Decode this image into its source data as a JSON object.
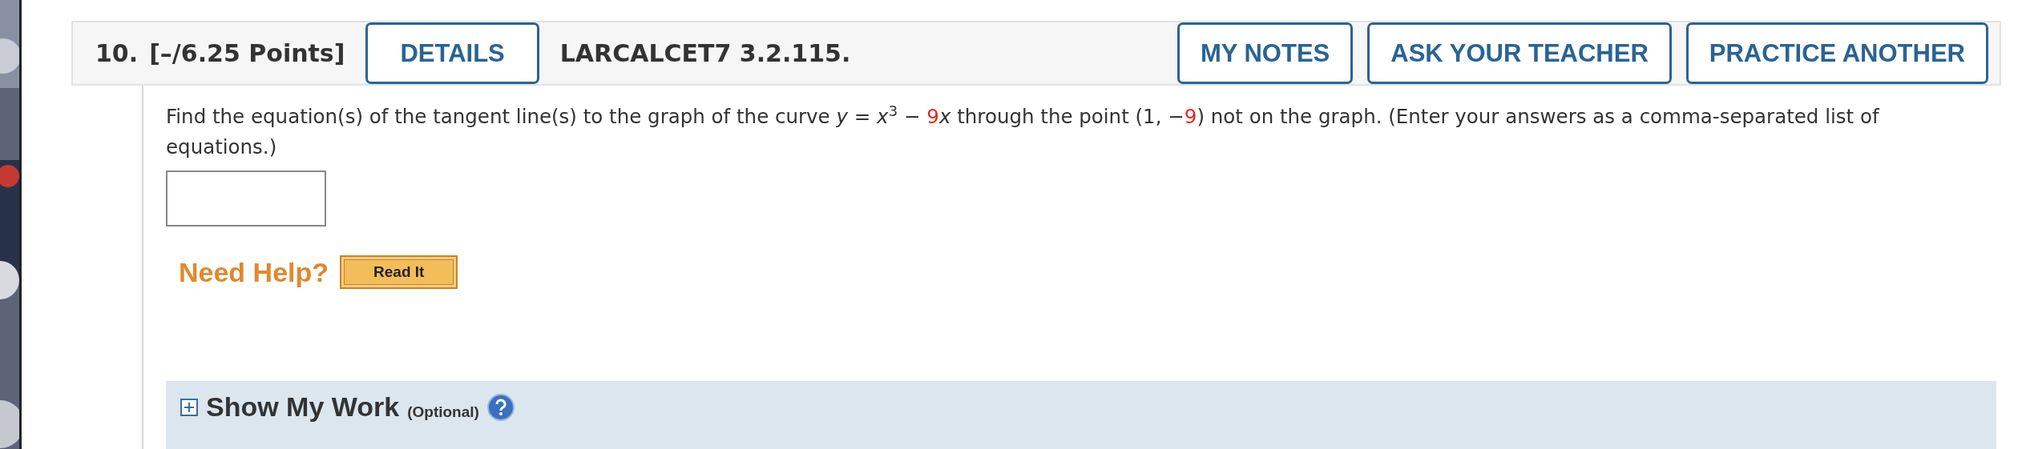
{
  "question": {
    "number": "10.",
    "points": "[–/6.25 Points]",
    "details_button": "DETAILS",
    "code": "LARCALCET7 3.2.115.",
    "actions": [
      "MY NOTES",
      "ASK YOUR TEACHER",
      "PRACTICE ANOTHER"
    ]
  },
  "prompt": [
    {
      "kind": "plain",
      "text": "Find the equation(s) of the tangent line(s) to the graph of the curve *y* = *x*$^{3}$ − "
    },
    {
      "kind": "given",
      "text": "9"
    },
    {
      "kind": "plain",
      "text": "*x* through the point (1, −"
    },
    {
      "kind": "given",
      "text": "9"
    },
    {
      "kind": "plain",
      "text": ") not on the graph. (Enter your answers as a comma-separated list of equations.)"
    }
  ],
  "help": {
    "label": "Need Help?",
    "buttons": [
      "Read It"
    ]
  },
  "work": {
    "title": "Show My Work",
    "note": "(Optional)",
    "expanded": false
  }
}
